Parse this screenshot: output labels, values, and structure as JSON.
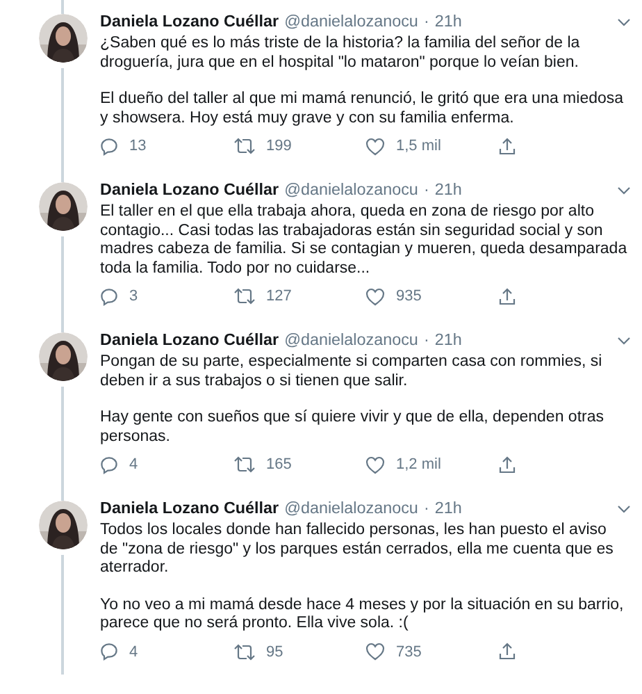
{
  "tweets": [
    {
      "name": "Daniela Lozano Cuéllar",
      "handle": "@danielalozanocu",
      "separator": "·",
      "time": "21h",
      "thread_above": true,
      "paragraphs": [
        "¿Saben qué es lo más triste de la historia? la familia del señor de la droguería, jura que en el hospital \"lo mataron\" porque lo veían bien.",
        "El dueño del taller al que mi mamá renunció, le gritó que era una miedosa y showsera. Hoy está muy grave y con su familia enferma."
      ],
      "replies": "13",
      "retweets": "199",
      "likes": "1,5 mil"
    },
    {
      "name": "Daniela Lozano Cuéllar",
      "handle": "@danielalozanocu",
      "separator": "·",
      "time": "21h",
      "thread_above": true,
      "paragraphs": [
        "El taller en el que ella trabaja ahora, queda en zona de riesgo por alto contagio... Casi todas las trabajadoras están sin seguridad social y son madres cabeza de familia. Si se contagian y mueren, queda desamparada toda la familia. Todo por no cuidarse..."
      ],
      "replies": "3",
      "retweets": "127",
      "likes": "935"
    },
    {
      "name": "Daniela Lozano Cuéllar",
      "handle": "@danielalozanocu",
      "separator": "·",
      "time": "21h",
      "thread_above": true,
      "paragraphs": [
        "Pongan de su parte, especialmente si comparten casa con rommies, si deben ir a sus trabajos o si tienen que salir.",
        "Hay gente con sueños que sí quiere vivir y que de ella, dependen otras personas."
      ],
      "replies": "4",
      "retweets": "165",
      "likes": "1,2 mil"
    },
    {
      "name": "Daniela Lozano Cuéllar",
      "handle": "@danielalozanocu",
      "separator": "·",
      "time": "21h",
      "thread_above": true,
      "paragraphs": [
        "Todos los locales donde han fallecido personas, les han puesto el aviso de \"zona de riesgo\" y los parques están cerrados, ella me cuenta que es aterrador.",
        "Yo no veo a mi mamá desde hace 4 meses y por la situación en su barrio, parece que no será pronto. Ella vive sola. :("
      ],
      "replies": "4",
      "retweets": "95",
      "likes": "735"
    }
  ]
}
